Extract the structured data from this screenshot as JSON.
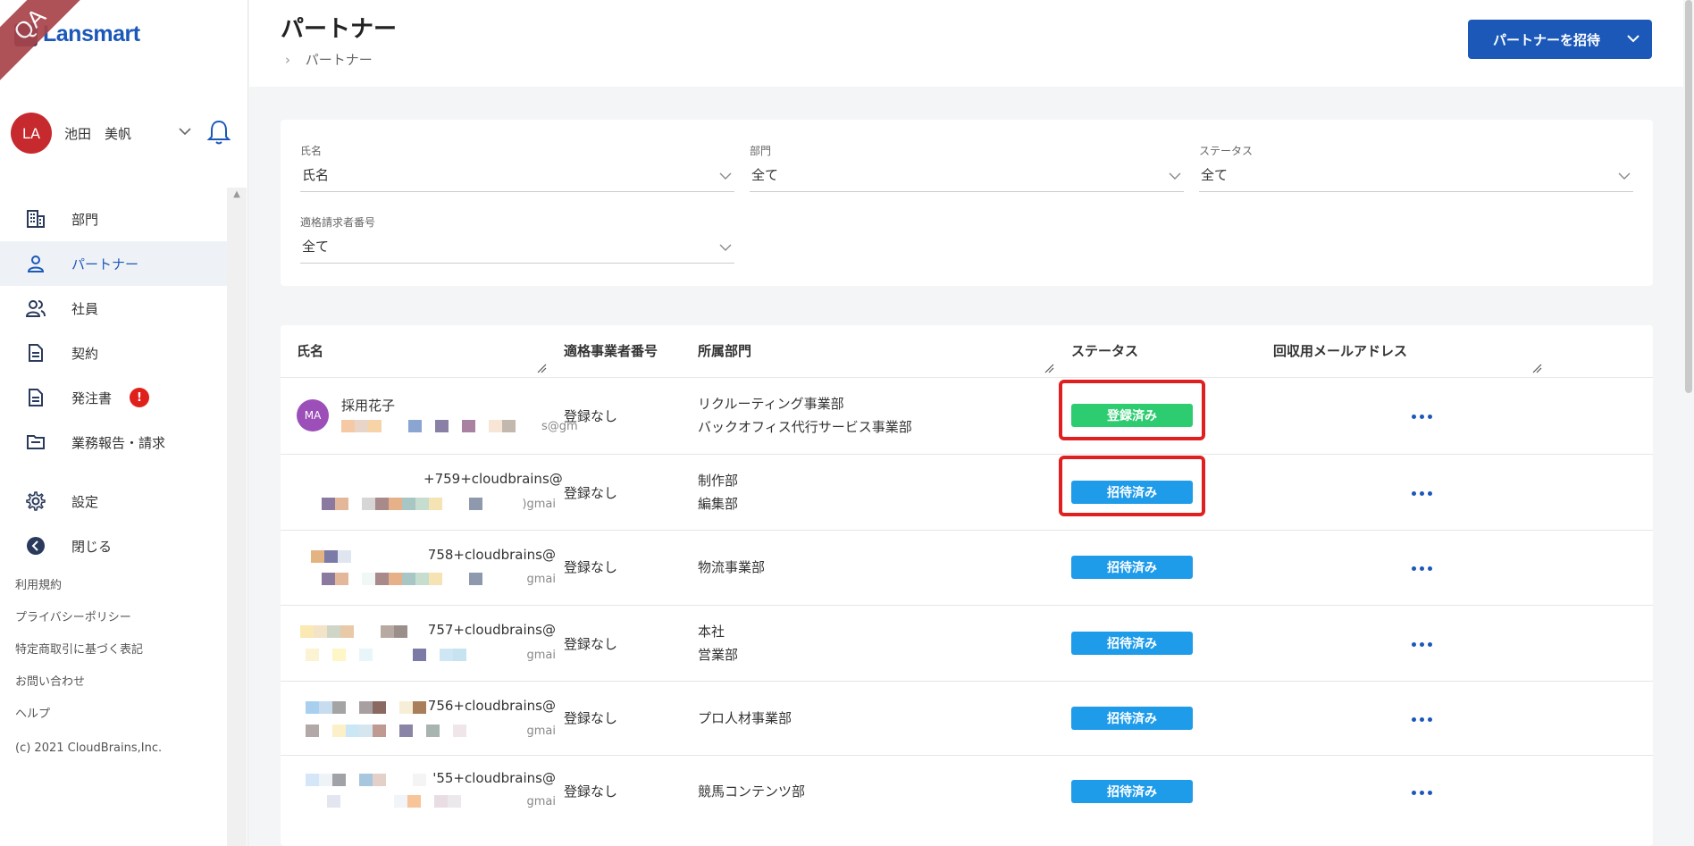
{
  "brand": {
    "name": "Lansmart",
    "ribbon": "QA"
  },
  "user": {
    "initials": "LA",
    "name": "池田　美帆"
  },
  "nav": {
    "items": [
      {
        "label": "部門",
        "icon": "building-icon"
      },
      {
        "label": "パートナー",
        "icon": "person-icon"
      },
      {
        "label": "社員",
        "icon": "people-icon"
      },
      {
        "label": "契約",
        "icon": "document-icon"
      },
      {
        "label": "発注書",
        "icon": "document-icon",
        "badge": "!"
      },
      {
        "label": "業務報告・請求",
        "icon": "folder-icon"
      }
    ],
    "settings": "設定",
    "close": "閉じる"
  },
  "footer": {
    "links": [
      "利用規約",
      "プライバシーポリシー",
      "特定商取引に基づく表記",
      "お問い合わせ",
      "ヘルプ"
    ],
    "copyright": "(c) 2021 CloudBrains,Inc."
  },
  "header": {
    "title": "パートナー",
    "breadcrumb": "パートナー",
    "invite_button": "パートナーを招待"
  },
  "filters": {
    "name": {
      "label": "氏名",
      "value": "氏名"
    },
    "department": {
      "label": "部門",
      "value": "全て"
    },
    "status": {
      "label": "ステータス",
      "value": "全て"
    },
    "invoice_number": {
      "label": "適格請求者番号",
      "value": "全て"
    }
  },
  "table": {
    "columns": [
      "氏名",
      "適格事業者番号",
      "所属部門",
      "ステータス",
      "回収用メールアドレス"
    ],
    "rows": [
      {
        "avatar": "MA",
        "name": "採用花子",
        "email_tail": "s@gm",
        "number": "登録なし",
        "departments": [
          "リクルーティング事業部",
          "バックオフィス代行サービス事業部"
        ],
        "status": "登録済み",
        "status_color": "#2ecc71"
      },
      {
        "email_head": "+759+cloudbrains@",
        "email_tail": ")gmai",
        "number": "登録なし",
        "departments": [
          "制作部",
          "編集部"
        ],
        "status": "招待済み",
        "status_color": "#1e9be9"
      },
      {
        "email_head": "758+cloudbrains@",
        "email_tail": "gmai",
        "number": "登録なし",
        "departments": [
          "物流事業部"
        ],
        "status": "招待済み",
        "status_color": "#1e9be9"
      },
      {
        "email_head": "757+cloudbrains@",
        "email_tail": "gmai",
        "number": "登録なし",
        "departments": [
          "本社",
          "営業部"
        ],
        "status": "招待済み",
        "status_color": "#1e9be9"
      },
      {
        "email_head": "756+cloudbrains@",
        "email_tail": "gmai",
        "number": "登録なし",
        "departments": [
          "プロ人材事業部"
        ],
        "status": "招待済み",
        "status_color": "#1e9be9"
      },
      {
        "email_head": "'55+cloudbrains@",
        "email_tail": "gmai",
        "number": "登録なし",
        "departments": [
          "競馬コンテンツ部"
        ],
        "status": "招待済み",
        "status_color": "#1e9be9"
      }
    ]
  }
}
